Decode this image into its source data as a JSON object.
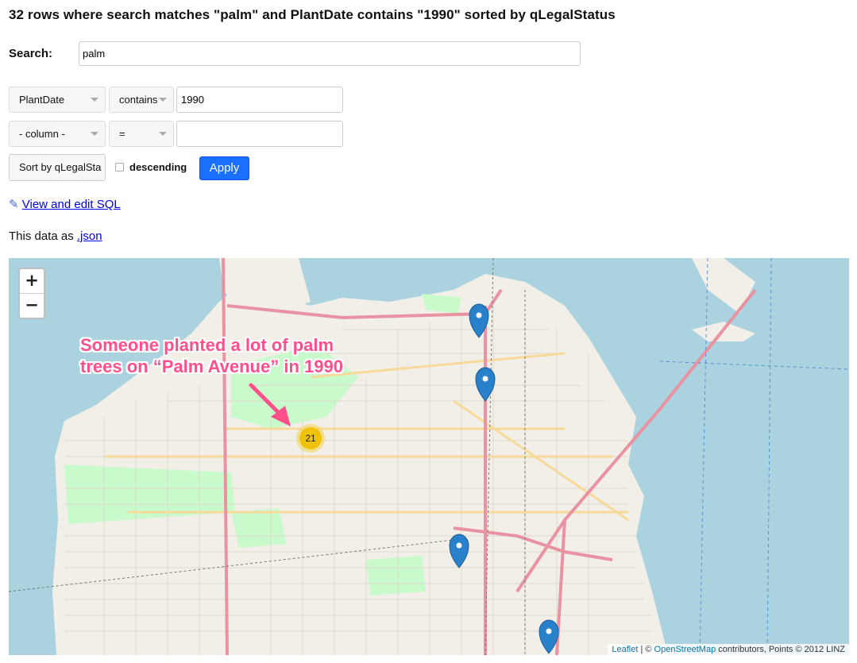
{
  "page": {
    "title": "32 rows where search matches \"palm\" and PlantDate contains \"1990\" sorted by qLegalStatus"
  },
  "search": {
    "label": "Search:",
    "value": "palm"
  },
  "filters": [
    {
      "column": "PlantDate",
      "operator": "contains",
      "value": "1990"
    },
    {
      "column": "- column -",
      "operator": "=",
      "value": ""
    }
  ],
  "sort": {
    "button_label": "Sort by qLegalSta",
    "descending_label": "descending",
    "descending_checked": false,
    "apply_label": "Apply"
  },
  "links": {
    "sql_icon": "✎",
    "sql_label": "View and edit SQL",
    "json_prefix": "This data as ",
    "json_label": ".json"
  },
  "map": {
    "zoom_in": "+",
    "zoom_out": "−",
    "annotation_line1": "Someone planted a lot of palm",
    "annotation_line2": "trees on “Palm Avenue” in 1990",
    "cluster_count": "21",
    "attribution_leaflet": "Leaflet",
    "attribution_sep": " | © ",
    "attribution_osm": "OpenStreetMap",
    "attribution_rest": " contributors, Points © 2012 LINZ",
    "colors": {
      "water": "#aad3df",
      "land": "#f2efe9",
      "park": "#c8facc",
      "marker": "#2a81cb",
      "cluster": "#f0c20c",
      "annotation": "#ff4f8b"
    }
  }
}
